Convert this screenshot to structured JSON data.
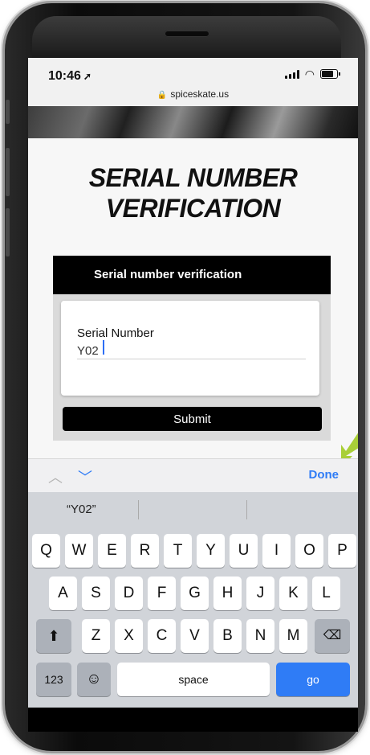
{
  "status_bar": {
    "time": "10:46",
    "location_arrow": "location-arrow-icon",
    "url": "spiceskate.us"
  },
  "page": {
    "title_line1": "SERIAL NUMBER",
    "title_line2": "VERIFICATION"
  },
  "card": {
    "header": "Serial number verification",
    "field_label": "Serial Number",
    "field_value": "Y02",
    "submit_label": "Submit"
  },
  "accessory_bar": {
    "done_label": "Done"
  },
  "keyboard": {
    "suggestion": "“Y02”",
    "row1": [
      "Q",
      "W",
      "E",
      "R",
      "T",
      "Y",
      "U",
      "I",
      "O",
      "P"
    ],
    "row2": [
      "A",
      "S",
      "D",
      "F",
      "G",
      "H",
      "J",
      "K",
      "L"
    ],
    "row3": [
      "Z",
      "X",
      "C",
      "V",
      "B",
      "N",
      "M"
    ],
    "numbers_label": "123",
    "space_label": "space",
    "go_label": "go"
  },
  "colors": {
    "accent": "#2f7cf6",
    "arrow": "#a9cf38",
    "header_bg": "#000000"
  }
}
